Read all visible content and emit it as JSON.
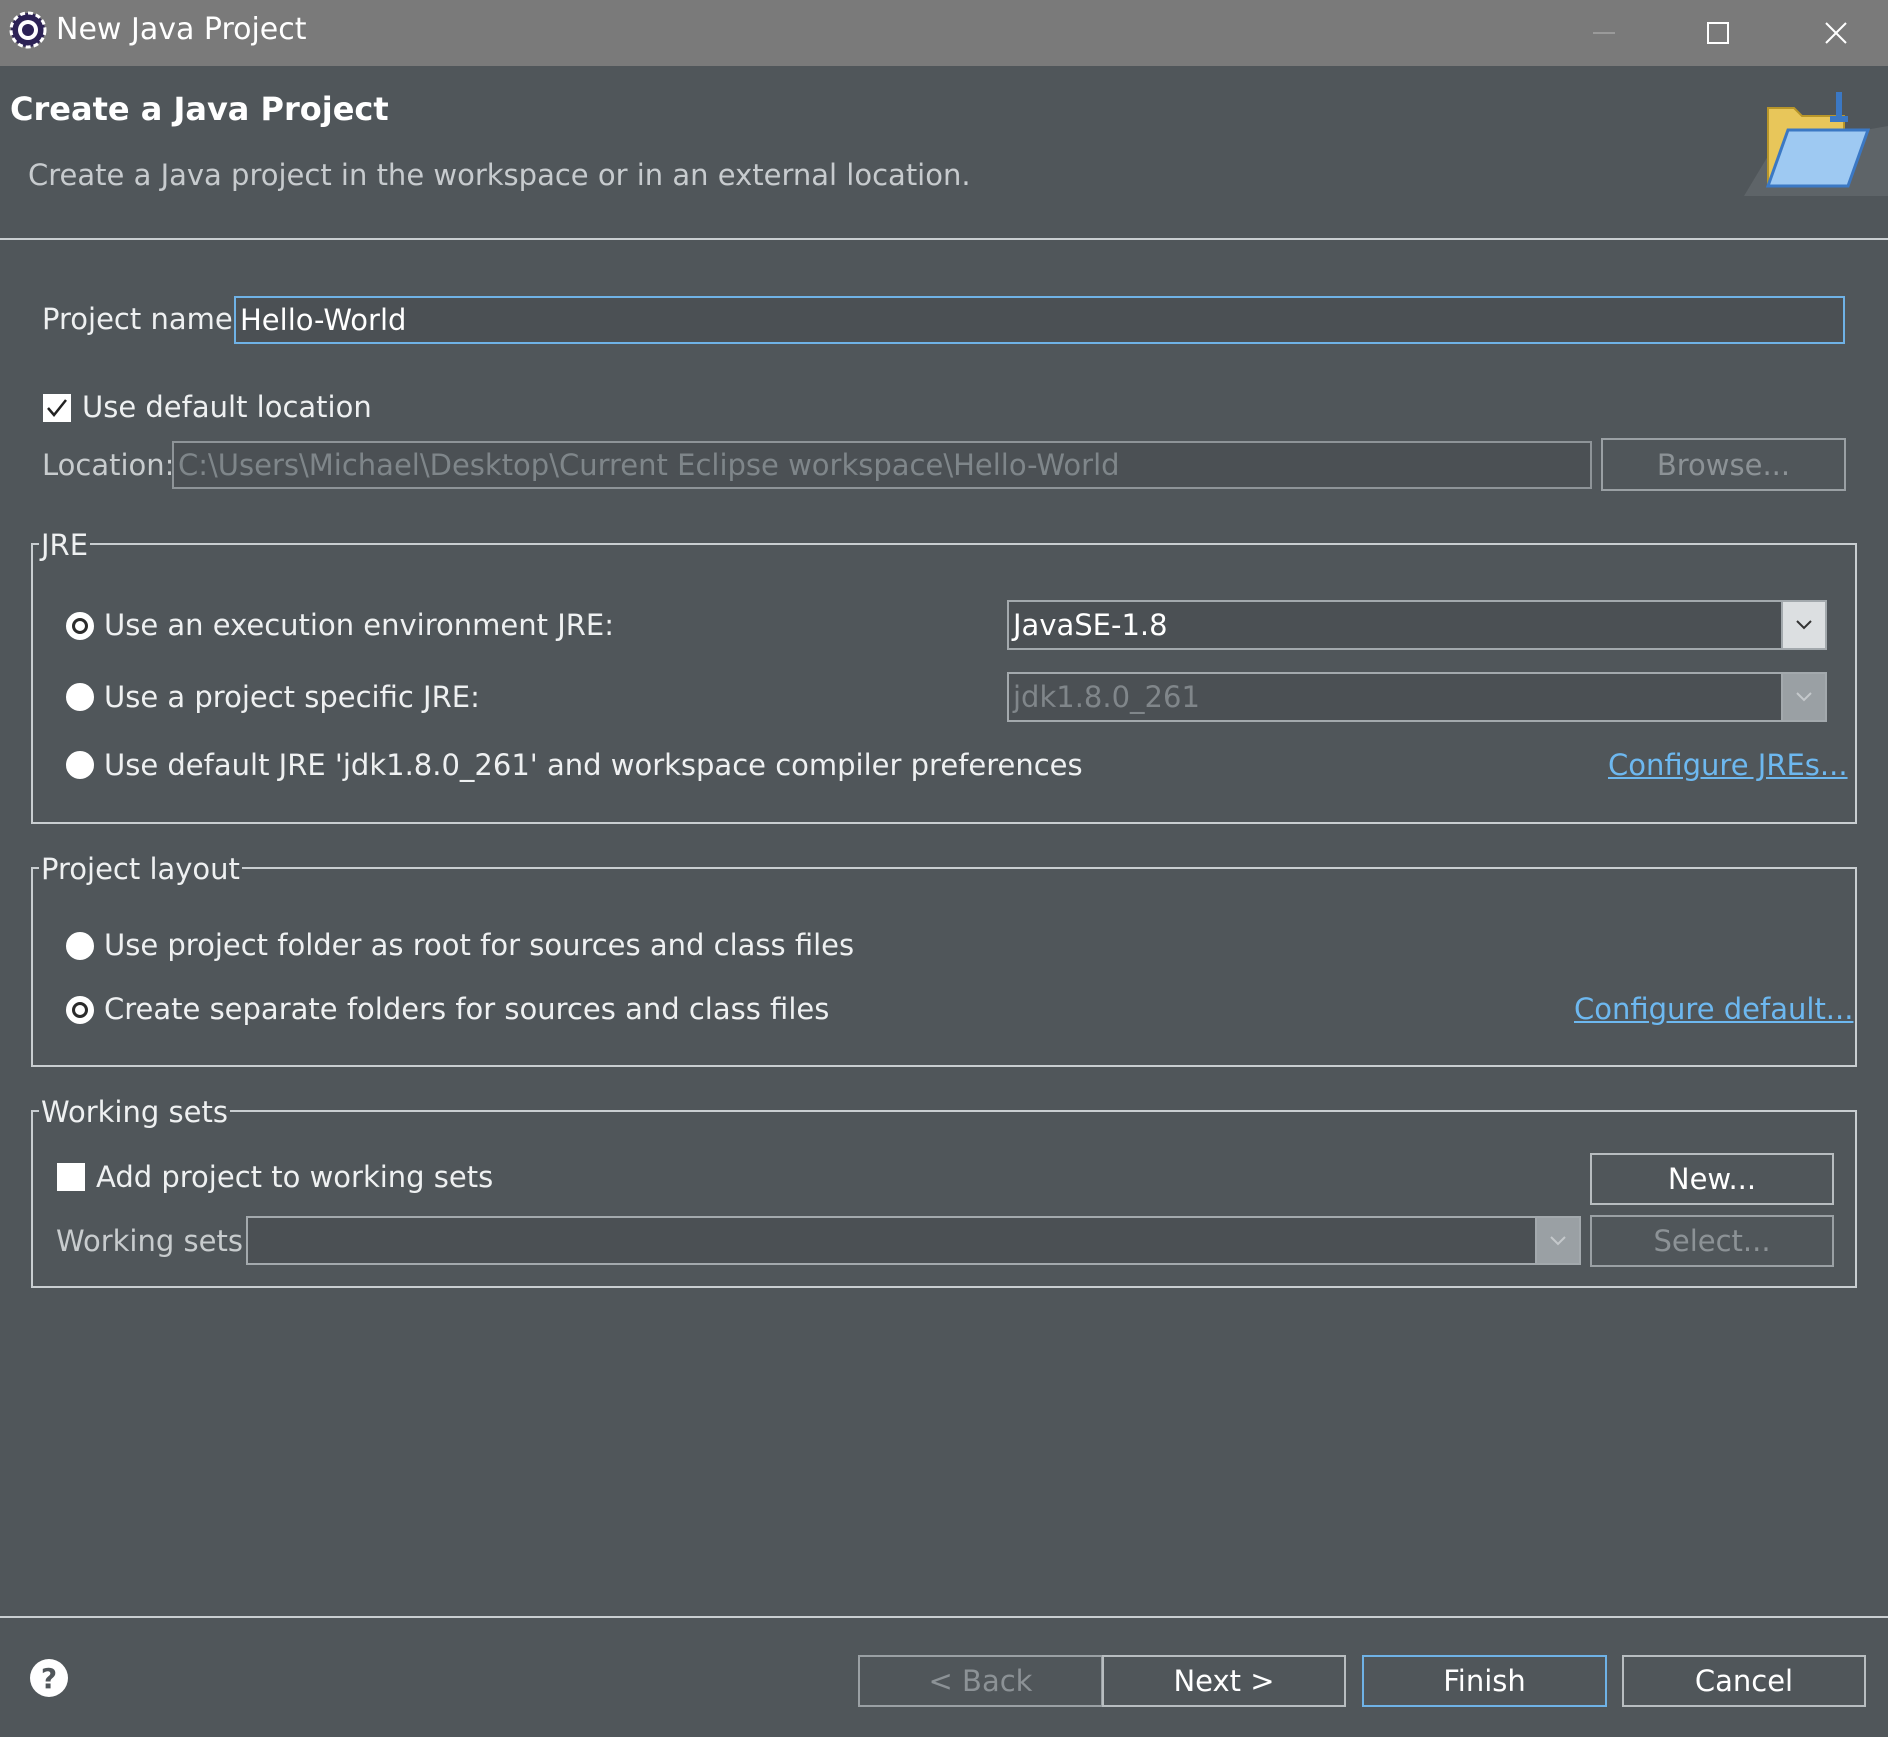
{
  "window": {
    "title": "New Java Project",
    "minimize_glyph": "—",
    "maximize_glyph": "☐",
    "close_glyph": "✕"
  },
  "header": {
    "title": "Create a Java Project",
    "description": "Create a Java project in the workspace or in an external location.",
    "icon": "new-java-project-folder-icon"
  },
  "project": {
    "name_label": "Project name:",
    "name_value": "Hello-World",
    "use_default_location_label": "Use default location",
    "use_default_location_checked": true,
    "location_label": "Location:",
    "location_value": "C:\\Users\\Michael\\Desktop\\Current Eclipse workspace\\Hello-World",
    "browse_label": "Browse..."
  },
  "jre": {
    "group_title": "JRE",
    "option_exec_env_label": "Use an execution environment JRE:",
    "option_exec_env_value": "JavaSE-1.8",
    "option_project_specific_label": "Use a project specific JRE:",
    "option_project_specific_value": "jdk1.8.0_261",
    "option_default_label": "Use default JRE 'jdk1.8.0_261' and workspace compiler preferences",
    "configure_link": "Configure JREs...",
    "selected": "exec_env"
  },
  "layout": {
    "group_title": "Project layout",
    "option_root_label": "Use project folder as root for sources and class files",
    "option_separate_label": "Create separate folders for sources and class files",
    "configure_link": "Configure default...",
    "selected": "separate"
  },
  "working_sets": {
    "group_title": "Working sets",
    "add_label": "Add project to working sets",
    "add_checked": false,
    "new_label": "New...",
    "sets_label": "Working sets:",
    "sets_value": "",
    "select_label": "Select..."
  },
  "footer": {
    "help_glyph": "?",
    "back_label": "< Back",
    "next_label": "Next >",
    "finish_label": "Finish",
    "cancel_label": "Cancel"
  },
  "colors": {
    "background": "#50565a",
    "titlebar": "#7a7a7a",
    "link": "#6db8f0",
    "focus_border": "#6fb2e6"
  }
}
